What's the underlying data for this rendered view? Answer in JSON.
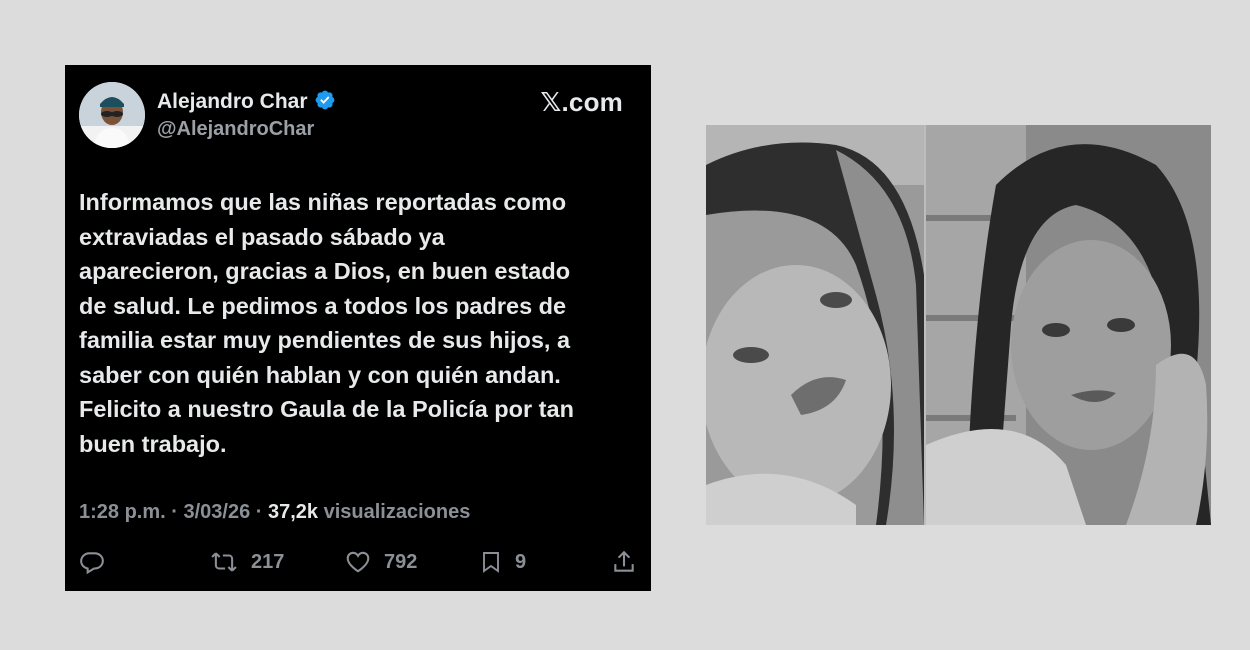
{
  "tweet": {
    "author_name": "Alejandro Char",
    "author_handle": "@AlejandroChar",
    "source": "𝕏.com",
    "text": "Informamos que las niñas reportadas como\nextraviadas el pasado sábado ya\naparecieron, gracias a Dios, en buen estado\nde salud. Le pedimos a todos los padres de\nfamilia estar muy pendientes de sus hijos, a\nsaber con quién hablan y con quién andan.\nFelicito a nuestro Gaula de la Policía por tan\nbuen trabajo.",
    "time": "1:28 p.m. · 3/03/26 · ",
    "views": "37,2k",
    "views_label": " visualizaciones",
    "actions": {
      "reply_icon": "reply-icon",
      "retweet_count": "217",
      "like_count": "792",
      "bookmark_count": "9",
      "share_icon": "share-icon"
    }
  },
  "colors": {
    "card_bg": "#000000",
    "verified": "#1d9bf0",
    "text": "#e7e9ea",
    "muted": "#8b9096",
    "page_bg": "#dcdcdc"
  },
  "photos": {
    "left": "grayscale-portrait-girl-1",
    "right": "grayscale-portrait-girl-2"
  }
}
